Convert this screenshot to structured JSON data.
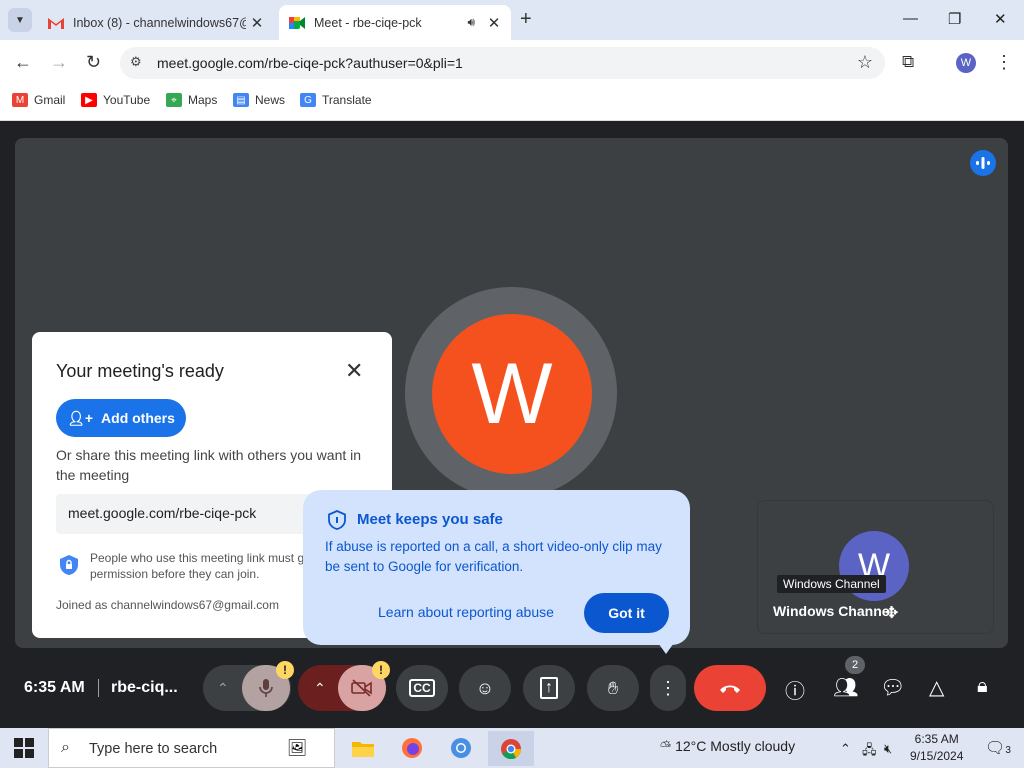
{
  "browser": {
    "tabs": [
      {
        "title": "Inbox (8) - channelwindows67@",
        "active": false
      },
      {
        "title": "Meet - rbe-ciqe-pck",
        "active": true
      }
    ],
    "url": "meet.google.com/rbe-ciqe-pck?authuser=0&pli=1",
    "profile_initial": "W",
    "bookmarks": [
      "Gmail",
      "YouTube",
      "Maps",
      "News",
      "Translate"
    ]
  },
  "meet": {
    "main_avatar_initial": "W",
    "self_avatar_initial": "W",
    "self_name": "Windows Channel",
    "self_tooltip": "Windows Channel",
    "ready_card": {
      "title": "Your meeting's ready",
      "add_others": "Add others",
      "share_text": "Or share this meeting link with others you want in the meeting",
      "link": "meet.google.com/rbe-ciqe-pck",
      "permission_text": "People who use this meeting link must get your permission before they can join.",
      "joined_as": "Joined as channelwindows67@gmail.com"
    },
    "safe_popup": {
      "title": "Meet keeps you safe",
      "body": "If abuse is reported on a call, a short video-only clip may be sent to Google for verification.",
      "learn_link": "Learn about reporting abuse",
      "got_it": "Got it"
    },
    "controls": {
      "time": "6:35 AM",
      "meeting_code": "rbe-ciq...",
      "people_count": "2"
    },
    "colors": {
      "accent": "#1a73e8",
      "avatar_main": "#f4511e",
      "avatar_self": "#5b63c4",
      "hangup": "#ea4335"
    }
  },
  "taskbar": {
    "search_placeholder": "Type here to search",
    "weather": "12°C  Mostly cloudy",
    "time": "6:35 AM",
    "date": "9/15/2024",
    "notifications": "3"
  }
}
